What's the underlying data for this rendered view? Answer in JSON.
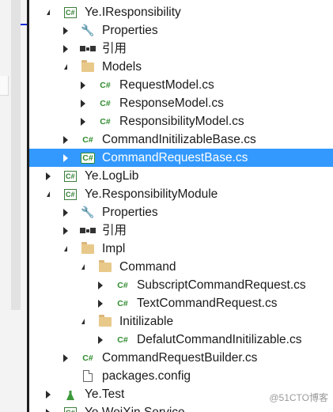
{
  "colors": {
    "selection": "#3399ff",
    "cs_icon": "#2e8b2e",
    "folder": "#dcb67a"
  },
  "icons": {
    "cs_glyph": "C#",
    "project": "csharp-project-icon",
    "cs_file": "csharp-file-icon",
    "folder": "folder-icon",
    "references": "references-icon",
    "properties": "wrench-icon",
    "config": "config-file-icon",
    "test_project": "test-project-icon"
  },
  "tree": {
    "project_iresp": "Ye.IResponsibility",
    "iresp_properties": "Properties",
    "iresp_references": "引用",
    "iresp_models": "Models",
    "request_model": "RequestModel.cs",
    "response_model": "ResponseModel.cs",
    "responsibility_model": "ResponsibilityModel.cs",
    "command_initilizable_base": "CommandInitilizableBase.cs",
    "command_request_base": "CommandRequestBase.cs",
    "project_loglib": "Ye.LogLib",
    "project_module": "Ye.ResponsibilityModule",
    "module_properties": "Properties",
    "module_references": "引用",
    "module_impl": "Impl",
    "impl_command": "Command",
    "subscript_command_request": "SubscriptCommandRequest.cs",
    "text_command_request": "TextCommandRequest.cs",
    "impl_initilizable": "Initilizable",
    "default_command_initilizable": "DefalutCommandInitilizable.cs",
    "command_request_builder": "CommandRequestBuilder.cs",
    "packages_config": "packages.config",
    "project_test": "Ye.Test",
    "project_weixin": "Ye.WeiXin.Service"
  },
  "watermark": "@51CTO博客"
}
